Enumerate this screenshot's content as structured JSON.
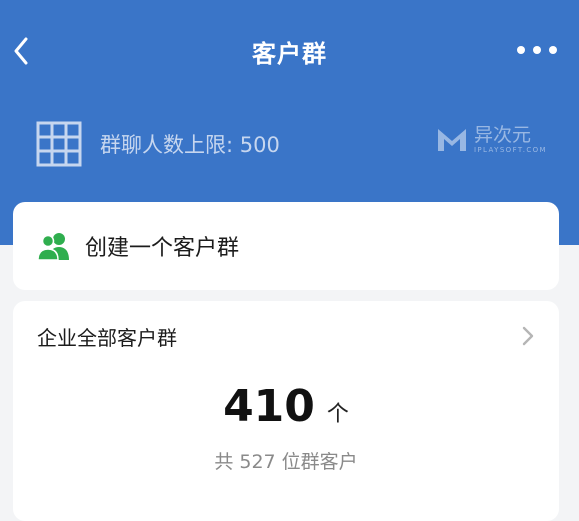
{
  "nav": {
    "title": "客户群",
    "back_icon": "chevron-left-icon",
    "more_icon": "more-horizontal-icon"
  },
  "limit": {
    "label": "群聊人数上限: 500",
    "icon": "grid-icon"
  },
  "watermark": {
    "text": "异次元",
    "sub": "IPLAYSOFT.COM"
  },
  "create": {
    "label": "创建一个客户群",
    "icon": "group-users-icon"
  },
  "all_groups": {
    "title": "企业全部客户群",
    "count": "410",
    "unit": "个",
    "summary": "共 527 位群客户"
  },
  "colors": {
    "header_bg": "#3a75c8",
    "page_bg": "#f3f4f6",
    "accent_green": "#2fae4e"
  }
}
